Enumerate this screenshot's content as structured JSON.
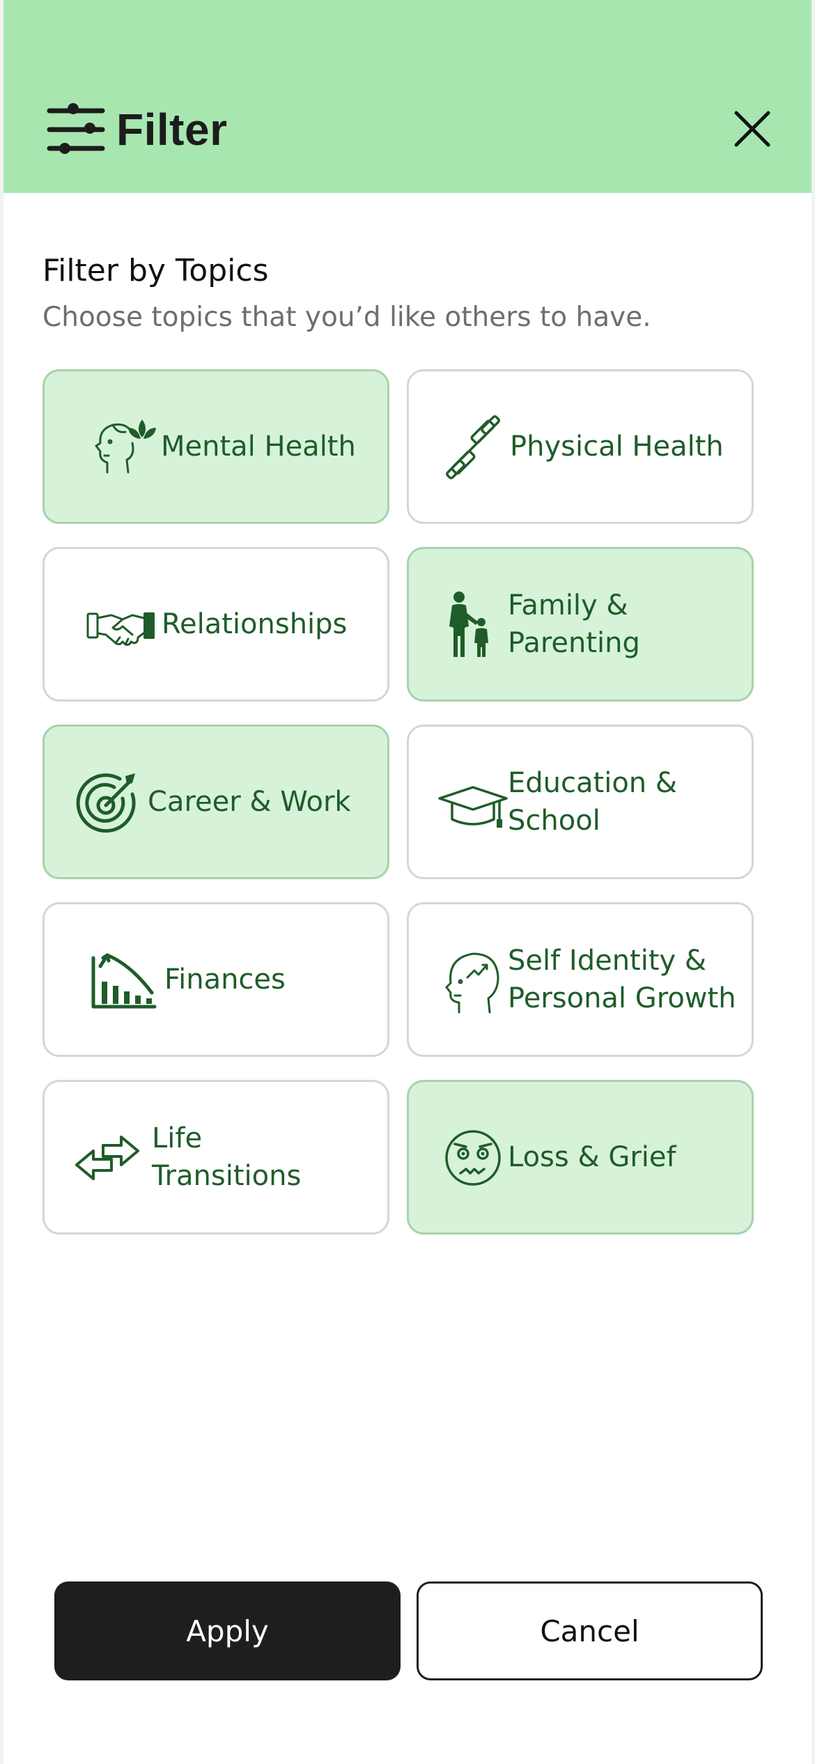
{
  "header": {
    "title": "Filter",
    "icon": "sliders-icon",
    "close_icon": "close-icon",
    "background": "#a8e6b0"
  },
  "section": {
    "title": "Filter by Topics",
    "subtitle": "Choose topics that you’d like others to have."
  },
  "topics": [
    {
      "label": "Mental Health",
      "icon": "mental-health-icon",
      "selected": true
    },
    {
      "label": "Physical Health",
      "icon": "dumbbell-icon",
      "selected": false
    },
    {
      "label": "Relationships",
      "icon": "handshake-icon",
      "selected": false
    },
    {
      "label": "Family &\nParenting",
      "icon": "parent-child-icon",
      "selected": true
    },
    {
      "label": "Career & Work",
      "icon": "target-icon",
      "selected": true
    },
    {
      "label": "Education &\nSchool",
      "icon": "graduation-cap-icon",
      "selected": false
    },
    {
      "label": "Finances",
      "icon": "finance-chart-icon",
      "selected": false
    },
    {
      "label": "Self Identity &\nPersonal Growth",
      "icon": "head-growth-icon",
      "selected": false
    },
    {
      "label": "Life\nTransitions",
      "icon": "swap-arrows-icon",
      "selected": false
    },
    {
      "label": "Loss & Grief",
      "icon": "sad-face-icon",
      "selected": true
    }
  ],
  "actions": {
    "apply_label": "Apply",
    "cancel_label": "Cancel"
  },
  "colors": {
    "accent_text": "#1f5c2a",
    "selected_fill": "#d6f3d9",
    "primary_button": "#1e1e1e"
  }
}
